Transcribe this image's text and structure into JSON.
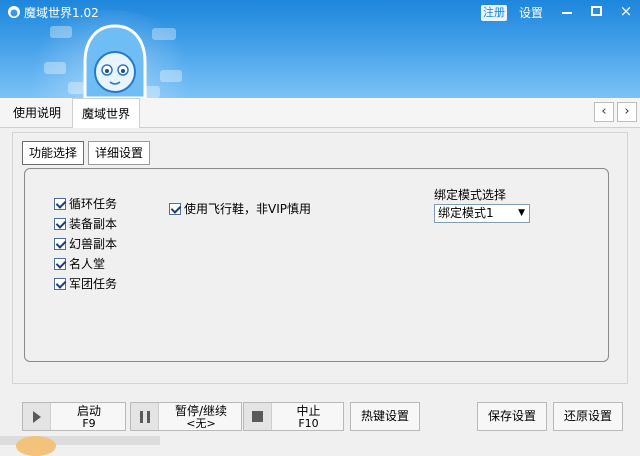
{
  "window": {
    "title": "魔域世界1.02",
    "register_label": "注册",
    "settings_label": "设置",
    "minimize_glyph": "–",
    "maximize_glyph": "□",
    "close_glyph": "×"
  },
  "top_tabs": [
    {
      "label": "使用说明"
    },
    {
      "label": "魔域世界"
    }
  ],
  "nav": {
    "left": "‹",
    "right": "›"
  },
  "sub_tabs": [
    {
      "label": "功能选择"
    },
    {
      "label": "详细设置"
    }
  ],
  "tasks": [
    {
      "label": "循环任务",
      "checked": true
    },
    {
      "label": "装备副本",
      "checked": true
    },
    {
      "label": "幻兽副本",
      "checked": true
    },
    {
      "label": "名人堂",
      "checked": true
    },
    {
      "label": "军团任务",
      "checked": true
    }
  ],
  "fly_shoes": {
    "label": "使用飞行鞋，非VIP慎用",
    "checked": true
  },
  "bind_mode": {
    "label": "绑定模式选择",
    "selected": "绑定模式1",
    "arrow": "▼"
  },
  "buttons": {
    "start": {
      "label": "启动",
      "key": "F9"
    },
    "pause": {
      "label": "暂停/继续",
      "key": "<无>"
    },
    "stop": {
      "label": "中止",
      "key": "F10"
    },
    "hotkey": {
      "label": "热键设置"
    },
    "save": {
      "label": "保存设置"
    },
    "restore": {
      "label": "还原设置"
    }
  },
  "colors": {
    "banner_blue": "#3a9ae6",
    "checkbox_border": "#4f6f9f"
  }
}
